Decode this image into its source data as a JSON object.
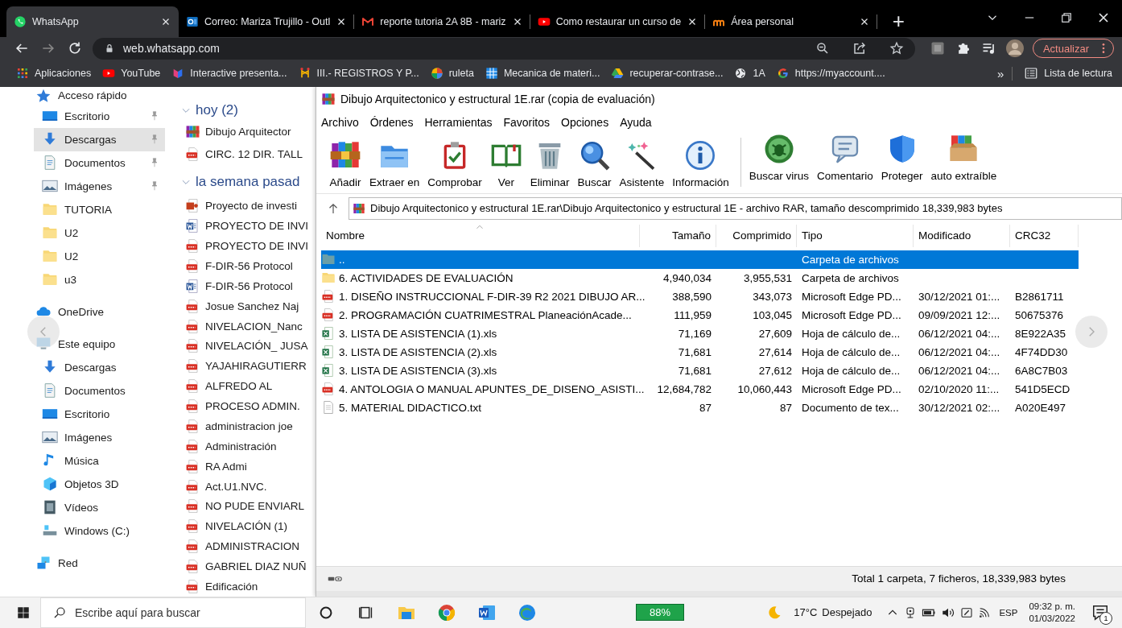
{
  "browser": {
    "tabs": [
      {
        "title": "WhatsApp",
        "selected": true
      },
      {
        "title": "Correo: Mariza Trujillo - Outl",
        "selected": false
      },
      {
        "title": "reporte tutoria 2A 8B - mariz",
        "selected": false
      },
      {
        "title": "Como restaurar un curso de",
        "selected": false
      },
      {
        "title": "Área personal",
        "selected": false
      }
    ],
    "new_tab": "+",
    "url": "web.whatsapp.com",
    "update_button": "Actualizar",
    "bookmarks": [
      "Aplicaciones",
      "YouTube",
      "Interactive presenta...",
      "III.- REGISTROS Y P...",
      "ruleta",
      "Mecanica de materi...",
      "recuperar-contrase...",
      "1A",
      "https://myaccount...."
    ],
    "bookmarks_more": "»",
    "reading_list": "Lista de lectura"
  },
  "explorer": {
    "nav": [
      {
        "label": "Acceso rápido",
        "kind": "section",
        "pinned": false,
        "selected": false
      },
      {
        "label": "Escritorio",
        "kind": "item",
        "pinned": true,
        "selected": false
      },
      {
        "label": "Descargas",
        "kind": "item",
        "pinned": true,
        "selected": true
      },
      {
        "label": "Documentos",
        "kind": "item",
        "pinned": true,
        "selected": false
      },
      {
        "label": "Imágenes",
        "kind": "item",
        "pinned": true,
        "selected": false
      },
      {
        "label": "TUTORIA",
        "kind": "item",
        "pinned": false,
        "selected": false
      },
      {
        "label": "U2",
        "kind": "item",
        "pinned": false,
        "selected": false
      },
      {
        "label": "U2",
        "kind": "item",
        "pinned": false,
        "selected": false
      },
      {
        "label": "u3",
        "kind": "item",
        "pinned": false,
        "selected": false
      },
      {
        "label": "OneDrive",
        "kind": "section",
        "pinned": false,
        "selected": false
      },
      {
        "label": "Este equipo",
        "kind": "section",
        "pinned": false,
        "selected": false
      },
      {
        "label": "Descargas",
        "kind": "item",
        "pinned": false,
        "selected": false
      },
      {
        "label": "Documentos",
        "kind": "item",
        "pinned": false,
        "selected": false
      },
      {
        "label": "Escritorio",
        "kind": "item",
        "pinned": false,
        "selected": false
      },
      {
        "label": "Imágenes",
        "kind": "item",
        "pinned": false,
        "selected": false
      },
      {
        "label": "Música",
        "kind": "item",
        "pinned": false,
        "selected": false
      },
      {
        "label": "Objetos 3D",
        "kind": "item",
        "pinned": false,
        "selected": false
      },
      {
        "label": "Vídeos",
        "kind": "item",
        "pinned": false,
        "selected": false
      },
      {
        "label": "Windows (C:)",
        "kind": "item",
        "pinned": false,
        "selected": false
      },
      {
        "label": "Red",
        "kind": "section",
        "pinned": false,
        "selected": false
      }
    ],
    "groups": [
      {
        "label": "hoy (2)",
        "files": [
          {
            "name": "Dibujo Arquitector",
            "kind": "rar"
          },
          {
            "name": "CIRC. 12 DIR.  TALL",
            "kind": "pdf"
          }
        ]
      },
      {
        "label": "la semana pasad",
        "files": [
          {
            "name": "Proyecto de investi",
            "kind": "ppt"
          },
          {
            "name": "PROYECTO DE INVI",
            "kind": "word"
          },
          {
            "name": "PROYECTO DE INVI",
            "kind": "pdf"
          },
          {
            "name": "F-DIR-56 Protocol",
            "kind": "pdf"
          },
          {
            "name": "F-DIR-56 Protocol",
            "kind": "word"
          },
          {
            "name": "Josue Sanchez Naj",
            "kind": "pdf"
          },
          {
            "name": "NIVELACION_Nanc",
            "kind": "pdf"
          },
          {
            "name": "NIVELACIÓN_ JUSA",
            "kind": "pdf"
          },
          {
            "name": "YAJAHIRAGUTIERR",
            "kind": "pdf"
          },
          {
            "name": "ALFREDO AL",
            "kind": "pdf"
          },
          {
            "name": "PROCESO ADMIN.",
            "kind": "pdf"
          },
          {
            "name": "administracion joe",
            "kind": "pdf"
          },
          {
            "name": "Administración",
            "kind": "pdf"
          },
          {
            "name": "RA Admi",
            "kind": "pdf"
          },
          {
            "name": "Act.U1.NVC.",
            "kind": "pdf"
          },
          {
            "name": "NO PUDE ENVIARL",
            "kind": "pdf"
          },
          {
            "name": "NIVELACIÓN (1)",
            "kind": "pdf"
          },
          {
            "name": "ADMINISTRACION",
            "kind": "pdf"
          },
          {
            "name": "GABRIEL DIAZ NUÑ",
            "kind": "pdf"
          },
          {
            "name": "Edificación",
            "kind": "pdf"
          }
        ]
      }
    ]
  },
  "winrar": {
    "title": "Dibujo Arquitectonico y estructural 1E.rar (copia de evaluación)",
    "menu": [
      "Archivo",
      "Órdenes",
      "Herramientas",
      "Favoritos",
      "Opciones",
      "Ayuda"
    ],
    "toolbar_groups": [
      {
        "buttons": [
          "Añadir",
          "Extraer en",
          "Comprobar",
          "Ver",
          "Eliminar",
          "Buscar",
          "Asistente",
          "Información"
        ]
      },
      {
        "buttons": [
          "Buscar virus",
          "Comentario",
          "Proteger",
          "auto extraíble"
        ]
      }
    ],
    "path": "Dibujo Arquitectonico y estructural 1E.rar\\Dibujo Arquitectonico y estructural 1E - archivo RAR, tamaño descomprimido 18,339,983 bytes",
    "columns": [
      "Nombre",
      "Tamaño",
      "Comprimido",
      "Tipo",
      "Modificado",
      "CRC32"
    ],
    "rows": [
      {
        "kind": "parent",
        "name": "..",
        "size": "",
        "packed": "",
        "type": "Carpeta de archivos",
        "modified": "",
        "crc": "",
        "selected": true
      },
      {
        "kind": "folder",
        "name": "6. ACTIVIDADES DE EVALUACIÓN",
        "size": "4,940,034",
        "packed": "3,955,531",
        "type": "Carpeta de archivos",
        "modified": "",
        "crc": "",
        "selected": false
      },
      {
        "kind": "pdf",
        "name": "1. DISEÑO INSTRUCCIONAL F-DIR-39 R2 2021 DIBUJO AR...",
        "size": "388,590",
        "packed": "343,073",
        "type": "Microsoft Edge PD...",
        "modified": "30/12/2021 01:...",
        "crc": "B2861711",
        "selected": false
      },
      {
        "kind": "pdf",
        "name": "2. PROGRAMACIÓN CUATRIMESTRAL PlaneaciónAcade...",
        "size": "111,959",
        "packed": "103,045",
        "type": "Microsoft Edge PD...",
        "modified": "09/09/2021 12:...",
        "crc": "50675376",
        "selected": false
      },
      {
        "kind": "xls",
        "name": "3. LISTA DE ASISTENCIA (1).xls",
        "size": "71,169",
        "packed": "27,609",
        "type": "Hoja de cálculo de...",
        "modified": "06/12/2021 04:...",
        "crc": "8E922A35",
        "selected": false
      },
      {
        "kind": "xls",
        "name": "3. LISTA DE ASISTENCIA (2).xls",
        "size": "71,681",
        "packed": "27,614",
        "type": "Hoja de cálculo de...",
        "modified": "06/12/2021 04:...",
        "crc": "4F74DD30",
        "selected": false
      },
      {
        "kind": "xls",
        "name": "3. LISTA DE ASISTENCIA (3).xls",
        "size": "71,681",
        "packed": "27,612",
        "type": "Hoja de cálculo de...",
        "modified": "06/12/2021 04:...",
        "crc": "6A8C7B03",
        "selected": false
      },
      {
        "kind": "pdf",
        "name": "4. ANTOLOGIA O MANUAL APUNTES_DE_DISENO_ASISTI...",
        "size": "12,684,782",
        "packed": "10,060,443",
        "type": "Microsoft Edge PD...",
        "modified": "02/10/2020 11:...",
        "crc": "541D5ECD",
        "selected": false
      },
      {
        "kind": "txt",
        "name": "5. MATERIAL DIDACTICO.txt",
        "size": "87",
        "packed": "87",
        "type": "Documento de tex...",
        "modified": "30/12/2021 02:...",
        "crc": "A020E497",
        "selected": false
      }
    ],
    "status": "Total 1 carpeta, 7 ficheros, 18,339,983 bytes"
  },
  "taskbar": {
    "search_placeholder": "Escribe aquí para buscar",
    "battery_percent": "88%",
    "temperature": "17°C",
    "weather": "Despejado",
    "language": "ESP",
    "time": "09:32 p. m.",
    "date": "01/03/2022",
    "notifications": "1"
  }
}
